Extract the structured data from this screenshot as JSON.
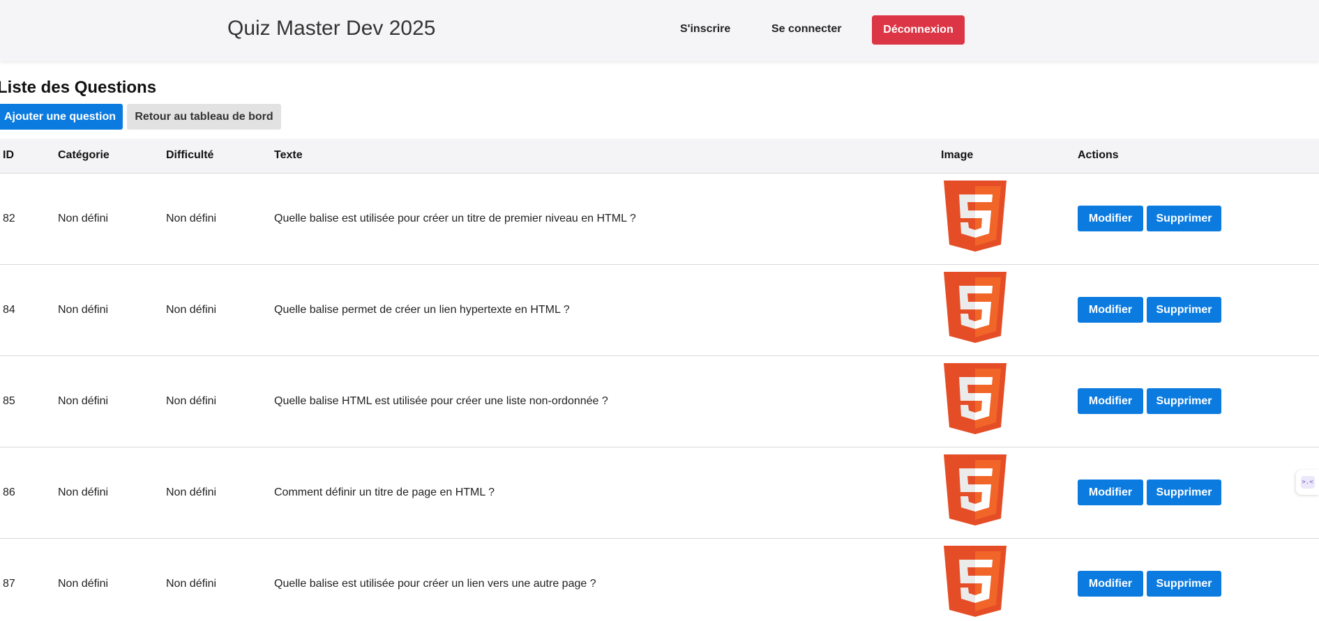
{
  "header": {
    "brand": "Quiz Master Dev 2025",
    "nav": {
      "signup_label": "S'inscrire",
      "login_label": "Se connecter",
      "logout_label": "Déconnexion"
    }
  },
  "main": {
    "title": "Liste des Questions",
    "add_label": "Ajouter une question",
    "back_label": "Retour au tableau de bord"
  },
  "table": {
    "headers": {
      "id": "ID",
      "category": "Catégorie",
      "difficulty": "Difficulté",
      "text": "Texte",
      "image": "Image",
      "actions": "Actions"
    },
    "rows": [
      {
        "id": "82",
        "category": "Non défini",
        "difficulty": "Non défini",
        "text": "Quelle balise est utilisée pour créer un titre de premier niveau en HTML ?",
        "image_icon": "html5-logo-icon",
        "edit_label": "Modifier",
        "delete_label": "Supprimer"
      },
      {
        "id": "84",
        "category": "Non défini",
        "difficulty": "Non défini",
        "text": "Quelle balise permet de créer un lien hypertexte en HTML ?",
        "image_icon": "html5-logo-icon",
        "edit_label": "Modifier",
        "delete_label": "Supprimer"
      },
      {
        "id": "85",
        "category": "Non défini",
        "difficulty": "Non défini",
        "text": "Quelle balise HTML est utilisée pour créer une liste non-ordonnée ?",
        "image_icon": "html5-logo-icon",
        "edit_label": "Modifier",
        "delete_label": "Supprimer"
      },
      {
        "id": "86",
        "category": "Non défini",
        "difficulty": "Non défini",
        "text": "Comment définir un titre de page en HTML ?",
        "image_icon": "html5-logo-icon",
        "edit_label": "Modifier",
        "delete_label": "Supprimer"
      },
      {
        "id": "87",
        "category": "Non défini",
        "difficulty": "Non défini",
        "text": "Quelle balise est utilisée pour créer un lien vers une autre page ?",
        "image_icon": "html5-logo-icon",
        "edit_label": "Modifier",
        "delete_label": "Supprimer"
      }
    ]
  },
  "colors": {
    "primary": "#0b7be0",
    "danger": "#dc3545",
    "secondary": "#e2e2e2",
    "header_bg": "#f5f5f7",
    "html5_orange": "#e44d26",
    "html5_light": "#f16529"
  },
  "side_widget": {
    "icon": "extension-widget-icon"
  }
}
